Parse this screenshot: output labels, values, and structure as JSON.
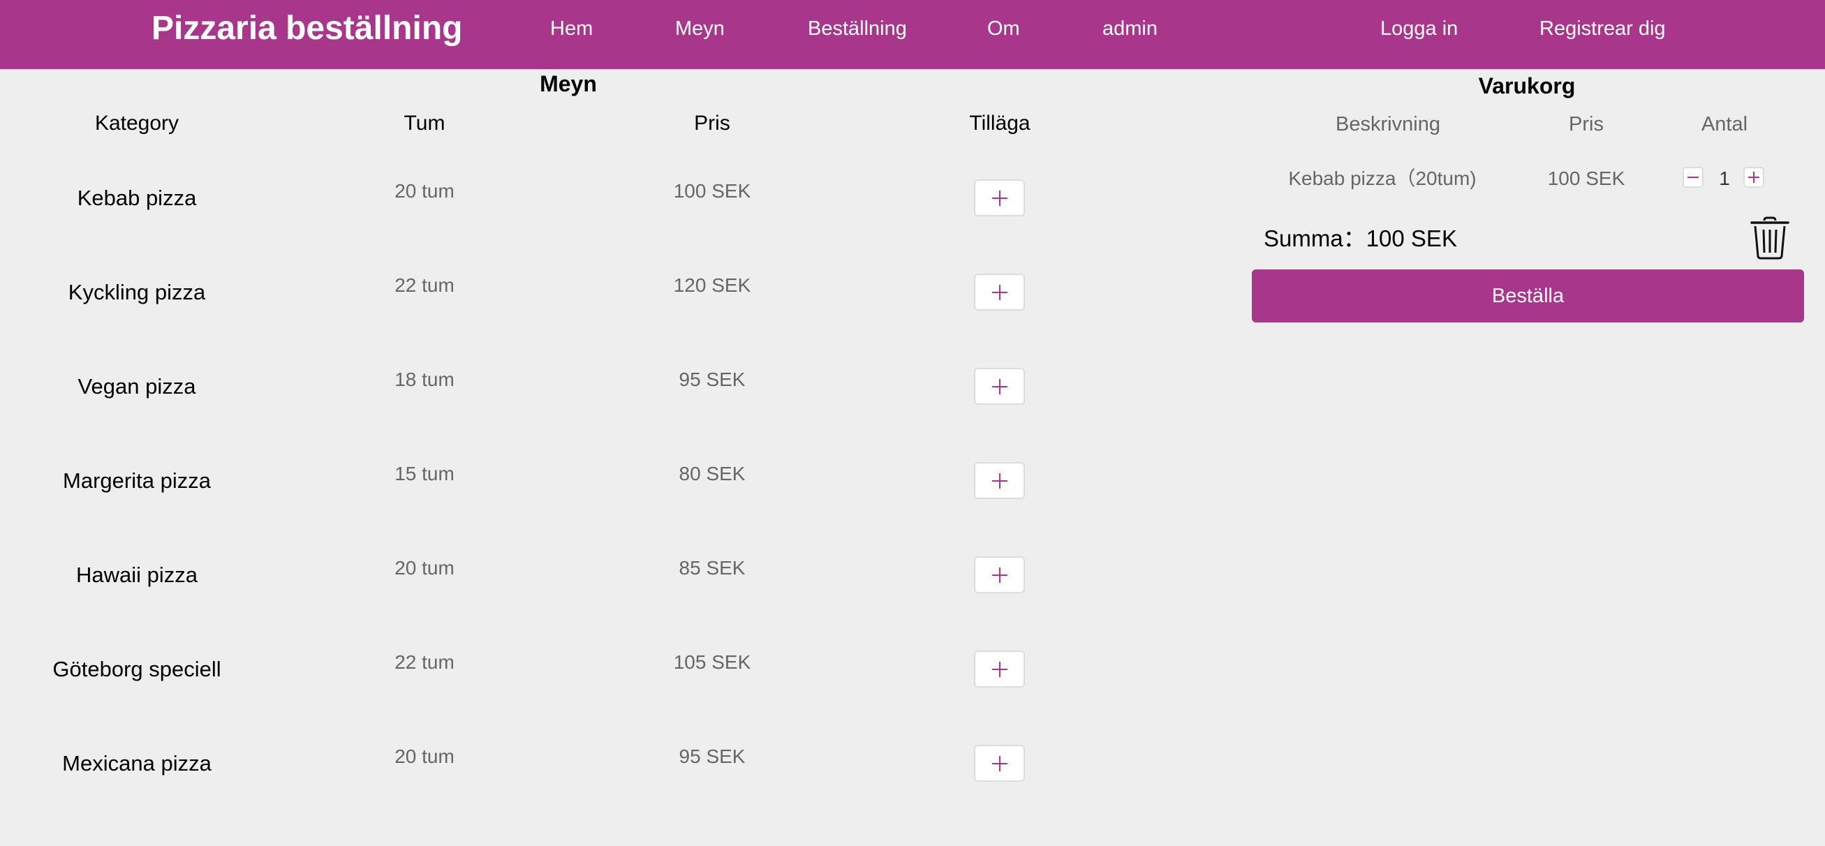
{
  "header": {
    "brand": "Pizzaria beställning",
    "nav": [
      "Hem",
      "Meyn",
      "Beställning",
      "Om",
      "admin"
    ],
    "auth": [
      "Logga in",
      "Registrear dig"
    ]
  },
  "menu": {
    "title": "Meyn",
    "columns": [
      "Kategory",
      "Tum",
      "Pris",
      "Tilläga"
    ],
    "rows": [
      {
        "name": "Kebab pizza",
        "size": "20 tum",
        "price": "100 SEK"
      },
      {
        "name": "Kyckling pizza",
        "size": "22 tum",
        "price": "120 SEK"
      },
      {
        "name": "Vegan pizza",
        "size": "18 tum",
        "price": "95 SEK"
      },
      {
        "name": "Margerita pizza",
        "size": "15 tum",
        "price": "80 SEK"
      },
      {
        "name": "Hawaii pizza",
        "size": "20 tum",
        "price": "85 SEK"
      },
      {
        "name": "Göteborg speciell",
        "size": "22 tum",
        "price": "105 SEK"
      },
      {
        "name": "Mexicana pizza",
        "size": "20 tum",
        "price": "95 SEK"
      }
    ]
  },
  "cart": {
    "title": "Varukorg",
    "columns": [
      "Beskrivning",
      "Pris",
      "Antal"
    ],
    "items": [
      {
        "description": "Kebab pizza（20tum)",
        "price": "100 SEK",
        "quantity": "1"
      }
    ],
    "total": "Summa：100 SEK",
    "order_label": "Beställa"
  },
  "icons": {
    "add": "plus-icon",
    "decrease": "minus-icon",
    "increase": "plus-icon",
    "clear": "trash-icon"
  },
  "colors": {
    "accent": "#a8378c",
    "background": "#eeeeee",
    "muted_text": "#666666"
  }
}
